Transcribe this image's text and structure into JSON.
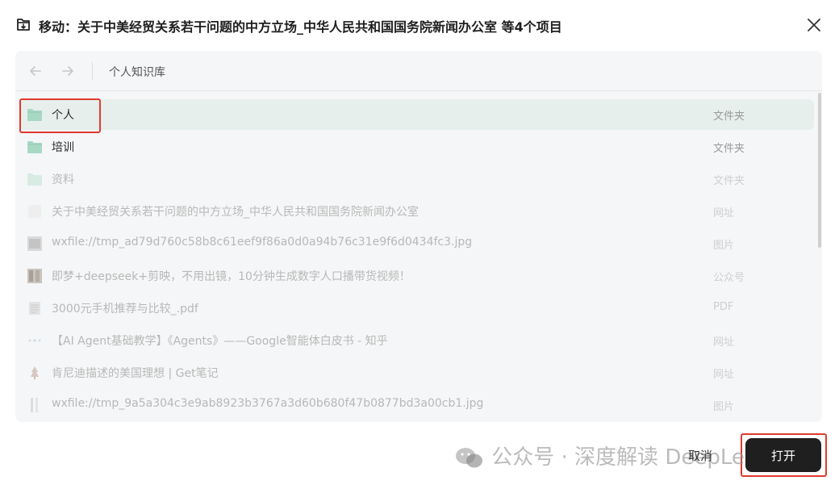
{
  "dialog": {
    "title": "移动：关于中美经贸关系若干问题的中方立场_中华人民共和国国务院新闻办公室 等4个项目",
    "icons": {
      "title_icon": "move-to-folder-icon",
      "close_icon": "close-icon"
    }
  },
  "toolbar": {
    "path_label": "个人知识库",
    "icons": {
      "back": "arrow-left-icon",
      "forward": "arrow-right-icon"
    }
  },
  "items": [
    {
      "name": "个人",
      "type": "文件夹",
      "icon": "folder-icon",
      "state": "selected"
    },
    {
      "name": "培训",
      "type": "文件夹",
      "icon": "folder-icon",
      "state": "enabled"
    },
    {
      "name": "资料",
      "type": "文件夹",
      "icon": "folder-icon",
      "state": "disabled"
    },
    {
      "name": "关于中美经贸关系若干问题的中方立场_中华人民共和国国务院新闻办公室",
      "type": "网址",
      "icon": "webpage-icon",
      "state": "disabled"
    },
    {
      "name": "wxfile://tmp_ad79d760c58b8c61eef9f86a0d0a94b76c31e9f6d0434fc3.jpg",
      "type": "图片",
      "icon": "image-thumbnail-icon",
      "state": "disabled"
    },
    {
      "name": "即梦+deepseek+剪映，不用出镜，10分钟生成数字人口播带货视频！",
      "type": "公众号",
      "icon": "article-thumbnail-icon",
      "state": "disabled"
    },
    {
      "name": "3000元手机推荐与比较_.pdf",
      "type": "PDF",
      "icon": "pdf-icon",
      "state": "disabled"
    },
    {
      "name": "【AI Agent基础教学】《Agents》——Google智能体白皮书 - 知乎",
      "type": "网址",
      "icon": "webpage-icon",
      "state": "disabled"
    },
    {
      "name": "肯尼迪描述的美国理想 | Get笔记",
      "type": "网址",
      "icon": "webpage-icon",
      "state": "disabled"
    },
    {
      "name": "wxfile://tmp_9a5a304c3e9ab8923b3767a3d60b680f47b0877bd3a00cb1.jpg",
      "type": "图片",
      "icon": "image-thumbnail-icon",
      "state": "disabled"
    }
  ],
  "footer": {
    "watermark": "公众号 · 深度解读 DeepLearn",
    "cancel_label": "取消",
    "open_label": "打开"
  },
  "colors": {
    "folder": "#a8d8c4",
    "selected_row": "#e6efeb",
    "primary_button": "#1f1f1f",
    "highlight_annotation": "#e03a2f"
  }
}
